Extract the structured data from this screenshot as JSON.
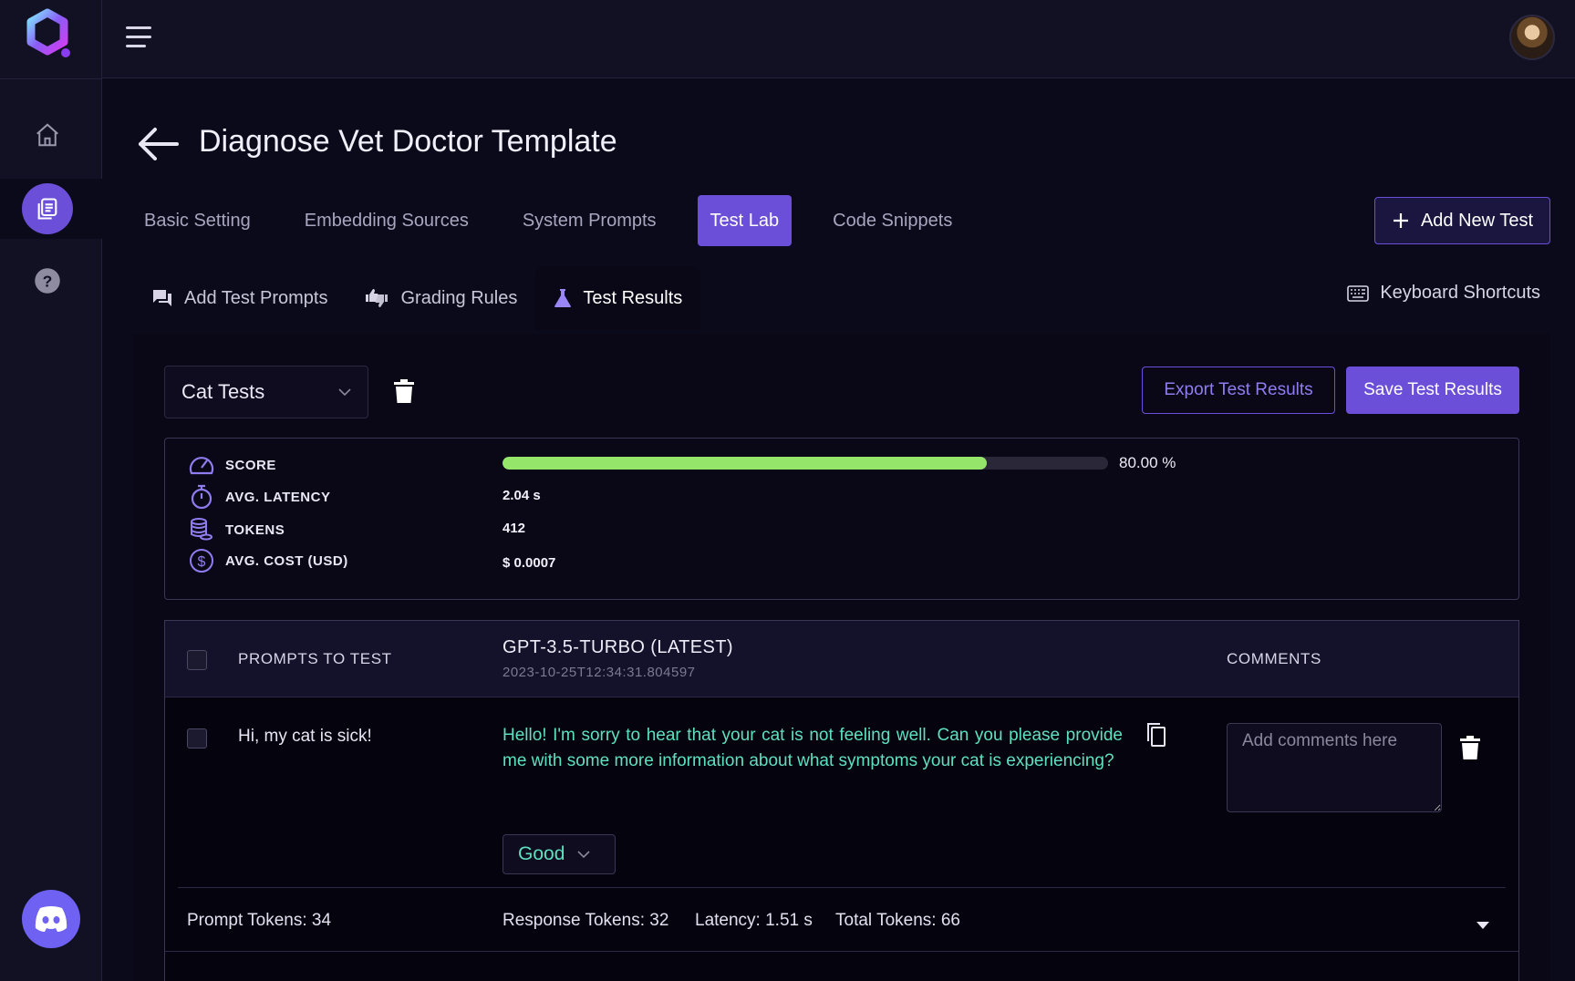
{
  "app": {
    "page_title": "Diagnose Vet Doctor Template"
  },
  "tabs": [
    {
      "label": "Basic Setting",
      "active": false
    },
    {
      "label": "Embedding Sources",
      "active": false
    },
    {
      "label": "System Prompts",
      "active": false
    },
    {
      "label": "Test Lab",
      "active": true
    },
    {
      "label": "Code Snippets",
      "active": false
    }
  ],
  "add_new_test_label": "Add New Test",
  "subtabs": [
    {
      "label": "Add Test Prompts",
      "icon": "chat-icon",
      "active": false
    },
    {
      "label": "Grading Rules",
      "icon": "thumbs-icon",
      "active": false
    },
    {
      "label": "Test Results",
      "icon": "flask-icon",
      "active": true
    }
  ],
  "keyboard_shortcuts_label": "Keyboard Shortcuts",
  "test_set": {
    "selected": "Cat Tests"
  },
  "actions": {
    "export_label": "Export Test Results",
    "save_label": "Save Test Results"
  },
  "metrics": {
    "score_label": "SCORE",
    "score_value": 80.0,
    "score_text": "80.00 %",
    "latency_label": "AVG. LATENCY",
    "latency_value": "2.04 s",
    "tokens_label": "TOKENS",
    "tokens_value": "412",
    "cost_label": "AVG. COST (USD)",
    "cost_value": "$ 0.0007"
  },
  "table": {
    "col_prompts": "PROMPTS TO TEST",
    "model_name": "GPT-3.5-TURBO (LATEST)",
    "model_timestamp": "2023-10-25T12:34:31.804597",
    "col_comments": "COMMENTS",
    "rows": [
      {
        "prompt": "Hi, my cat is sick!",
        "response": "Hello! I'm sorry to hear that your cat is not feeling well. Can you please provide me with some more information about what symptoms your cat is experiencing?",
        "grade": "Good",
        "comment_placeholder": "Add comments here",
        "prompt_tokens": "Prompt Tokens: 34",
        "response_tokens": "Response Tokens: 32",
        "latency": "Latency: 1.51 s",
        "total_tokens": "Total Tokens: 66"
      }
    ]
  },
  "colors": {
    "accent": "#6b4fd8",
    "response_text": "#5ee0c0",
    "progress": "#95e56a",
    "background": "#0b0a1a"
  }
}
